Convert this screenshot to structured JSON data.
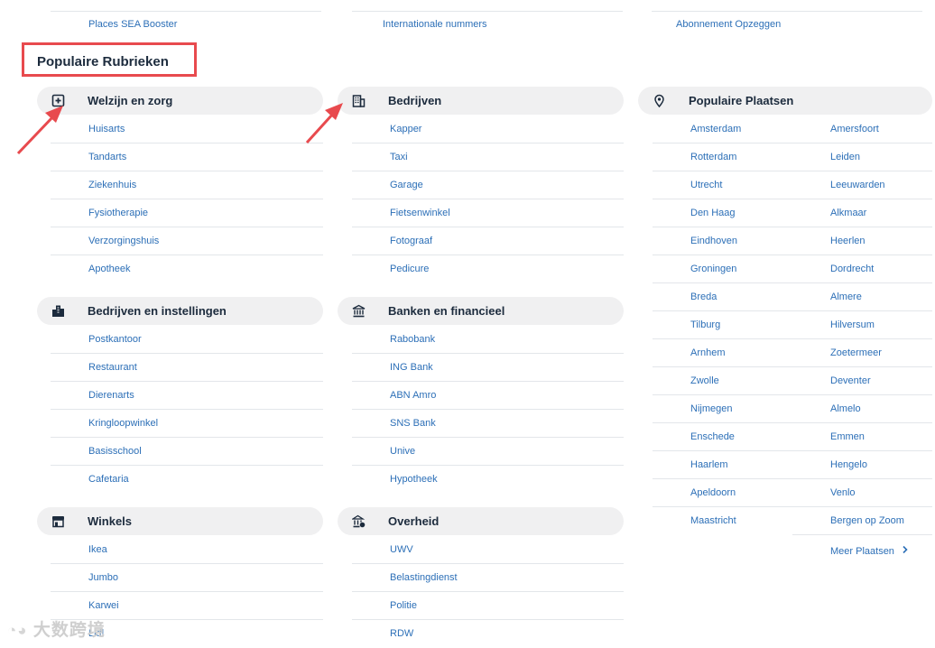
{
  "top_links": [
    "Places SEA Booster",
    "Internationale nummers",
    "Abonnement Opzeggen"
  ],
  "section_title": "Populaire Rubrieken",
  "categories": [
    {
      "title": "Welzijn en zorg",
      "icon": "medical-plus-icon",
      "items": [
        "Huisarts",
        "Tandarts",
        "Ziekenhuis",
        "Fysiotherapie",
        "Verzorgingshuis",
        "Apotheek"
      ]
    },
    {
      "title": "Bedrijven",
      "icon": "office-building-icon",
      "items": [
        "Kapper",
        "Taxi",
        "Garage",
        "Fietsenwinkel",
        "Fotograaf",
        "Pedicure"
      ]
    },
    {
      "title": "Bedrijven en instellingen",
      "icon": "city-buildings-icon",
      "items": [
        "Postkantoor",
        "Restaurant",
        "Dierenarts",
        "Kringloopwinkel",
        "Basisschool",
        "Cafetaria"
      ]
    },
    {
      "title": "Banken en financieel",
      "icon": "bank-icon",
      "items": [
        "Rabobank",
        "ING Bank",
        "ABN Amro",
        "SNS Bank",
        "Unive",
        "Hypotheek"
      ]
    },
    {
      "title": "Winkels",
      "icon": "storefront-icon",
      "items": [
        "Ikea",
        "Jumbo",
        "Karwei",
        "Lidl"
      ]
    },
    {
      "title": "Overheid",
      "icon": "government-building-icon",
      "items": [
        "UWV",
        "Belastingdienst",
        "Politie",
        "RDW"
      ]
    }
  ],
  "places": {
    "title": "Populaire Plaatsen",
    "icon": "map-pin-icon",
    "left": [
      "Amsterdam",
      "Rotterdam",
      "Utrecht",
      "Den Haag",
      "Eindhoven",
      "Groningen",
      "Breda",
      "Tilburg",
      "Arnhem",
      "Zwolle",
      "Nijmegen",
      "Enschede",
      "Haarlem",
      "Apeldoorn",
      "Maastricht"
    ],
    "right": [
      "Amersfoort",
      "Leiden",
      "Leeuwarden",
      "Alkmaar",
      "Heerlen",
      "Dordrecht",
      "Almere",
      "Hilversum",
      "Zoetermeer",
      "Deventer",
      "Almelo",
      "Emmen",
      "Hengelo",
      "Venlo",
      "Bergen op Zoom"
    ],
    "more_label": "Meer Plaatsen"
  },
  "watermark": "大数跨境",
  "colors": {
    "link": "#2c6fb7",
    "annotation": "#e84a4e",
    "header_bg": "#f0f0f1"
  }
}
